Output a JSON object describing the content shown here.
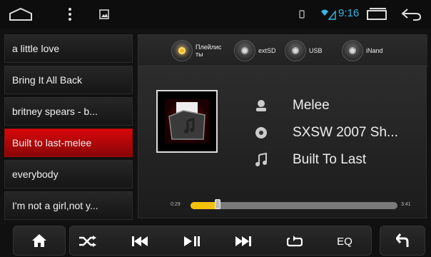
{
  "status_bar": {
    "time": "9:16",
    "icons": [
      "home-icon",
      "menu-icon",
      "gallery-icon",
      "notification-icon",
      "signal-icon",
      "recent-apps-icon",
      "back-icon"
    ],
    "time_color": "#37b6e6"
  },
  "playlist": {
    "items": [
      {
        "label": "a little love"
      },
      {
        "label": "Bring It All Back"
      },
      {
        "label": "britney spears - b..."
      },
      {
        "label": "Built to last-melee"
      },
      {
        "label": "everybody"
      },
      {
        "label": "I'm not a girl,not y..."
      }
    ],
    "active_index": 3,
    "active_color": "#d6080b"
  },
  "sources": [
    {
      "label_line1": "Плейлис",
      "label_line2": "ты",
      "active": true
    },
    {
      "label_line1": "extSD",
      "label_line2": "",
      "active": false
    },
    {
      "label_line1": "USB",
      "label_line2": "",
      "active": false
    },
    {
      "label_line1": "iNand",
      "label_line2": "",
      "active": false
    }
  ],
  "now_playing": {
    "artist": "Melee",
    "album": "SXSW 2007 Sh...",
    "title": "Built To Last",
    "artist_icon": "person-icon",
    "album_icon": "disc-icon",
    "title_icon": "music-note-icon"
  },
  "progress": {
    "current": "0:29",
    "total": "3:41",
    "fraction": 0.13,
    "fill_color": "#f4c20d"
  },
  "controls": {
    "home_icon": "home-icon",
    "shuffle_icon": "shuffle-icon",
    "prev_icon": "previous-icon",
    "play_pause_icon": "play-pause-icon",
    "next_icon": "next-icon",
    "repeat_icon": "repeat-icon",
    "eq_label": "EQ",
    "back_icon": "back-icon"
  }
}
